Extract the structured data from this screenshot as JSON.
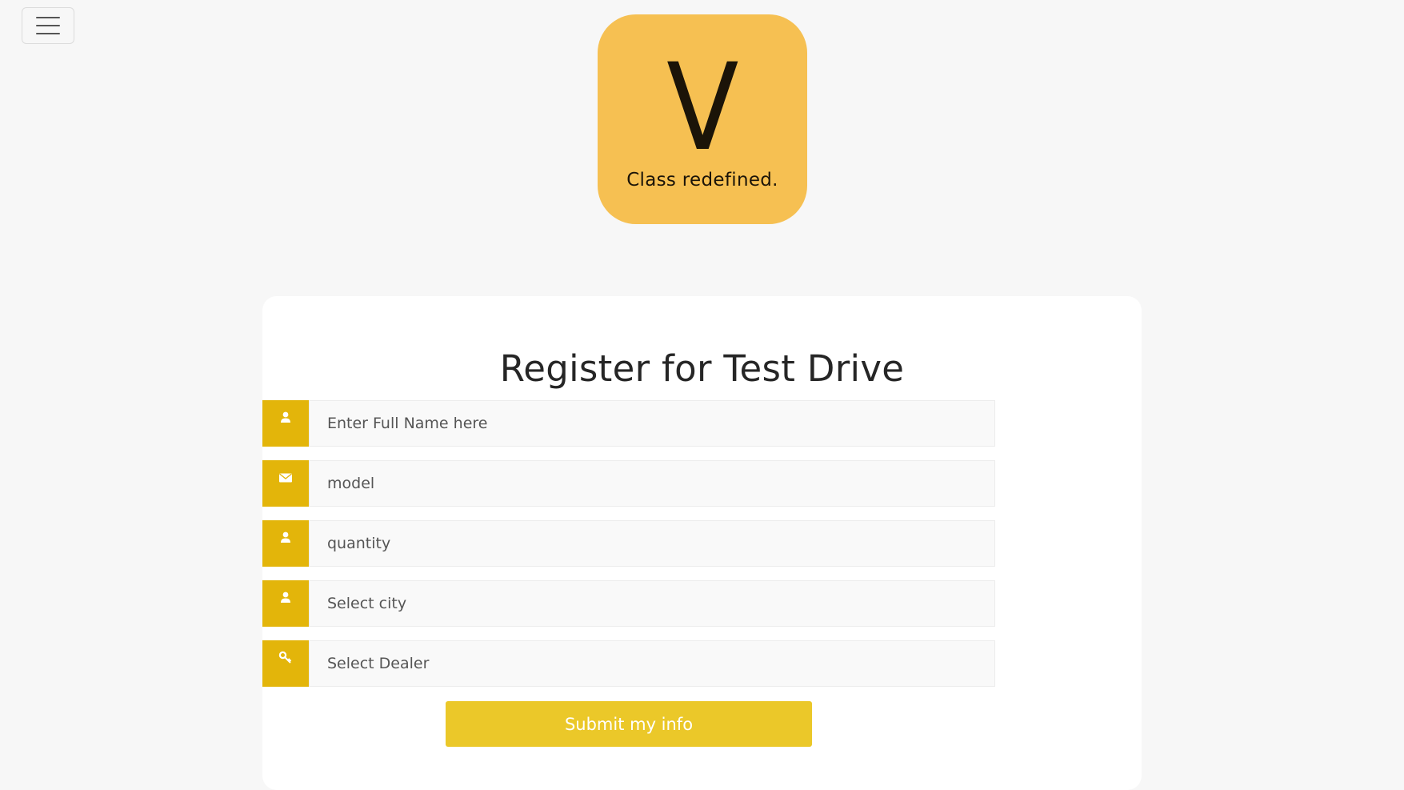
{
  "menu": {
    "icon": "hamburger-icon"
  },
  "logo": {
    "letter": "V",
    "tagline": "Class redefined.",
    "color": "#f6c052"
  },
  "form": {
    "title": "Register for Test Drive",
    "fields": [
      {
        "icon": "user-icon",
        "placeholder": "Enter Full Name here",
        "value": ""
      },
      {
        "icon": "envelope-icon",
        "placeholder": "model",
        "value": ""
      },
      {
        "icon": "user-icon",
        "placeholder": "quantity",
        "value": ""
      },
      {
        "icon": "user-icon",
        "placeholder": "Select city",
        "value": ""
      },
      {
        "icon": "key-icon",
        "placeholder": "Select Dealer",
        "value": ""
      }
    ],
    "submit_label": "Submit my info"
  },
  "colors": {
    "accent": "#e3b50a",
    "button": "#ebc829",
    "background": "#f7f7f7"
  }
}
